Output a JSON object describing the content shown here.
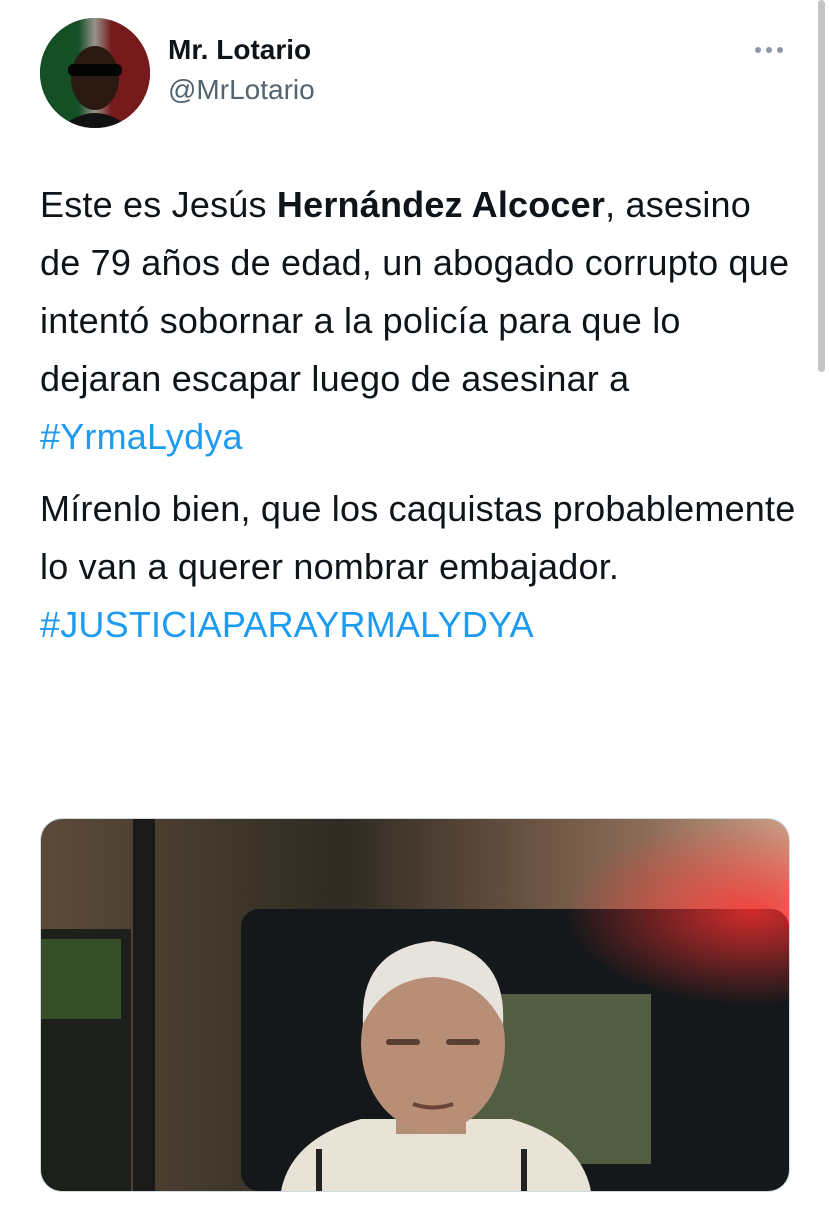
{
  "author": {
    "display_name": "Mr. Lotario",
    "handle": "@MrLotario"
  },
  "icons": {
    "more": "more-options-icon"
  },
  "tweet": {
    "p1_text_1": "Este es Jesús ",
    "p1_bold": "Hernández Alcocer",
    "p1_text_2": ", asesino de 79 años de edad, un abogado corrupto que intentó sobornar a la policía para que lo dejaran escapar luego de asesinar a ",
    "hashtag_1": "#YrmaLydya",
    "p2_text": "Mírenlo bien, que los caquistas probablemente lo van a querer nombrar embajador.",
    "hashtag_2": "#JUSTICIAPARAYRMALYDYA"
  },
  "colors": {
    "link": "#1d9bf0",
    "text": "#0f1419",
    "secondary": "#536471"
  }
}
